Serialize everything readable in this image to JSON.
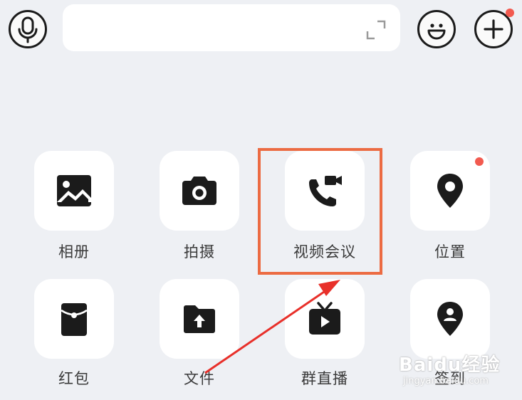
{
  "toolbar": {
    "input_value": "",
    "voice_icon": "microphone-icon",
    "emoji_icon": "smiley-icon",
    "more_icon": "plus-icon",
    "expand_icon": "expand-icon",
    "notification_color": "#f25a4f"
  },
  "panel": {
    "items": [
      {
        "label": "相册",
        "icon": "album-icon"
      },
      {
        "label": "拍摄",
        "icon": "camera-icon"
      },
      {
        "label": "视频会议",
        "icon": "video-call-icon"
      },
      {
        "label": "位置",
        "icon": "location-icon"
      },
      {
        "label": "红包",
        "icon": "red-envelope-icon"
      },
      {
        "label": "文件",
        "icon": "file-upload-icon"
      },
      {
        "label": "群直播",
        "icon": "live-tv-icon"
      },
      {
        "label": "签到",
        "icon": "check-in-icon"
      }
    ]
  },
  "annotation": {
    "highlight_color": "#ec6b42",
    "arrow_color": "#e8302a"
  },
  "watermark": {
    "text": "Baidu经验",
    "url_text": "jingyan.baidu.com"
  }
}
